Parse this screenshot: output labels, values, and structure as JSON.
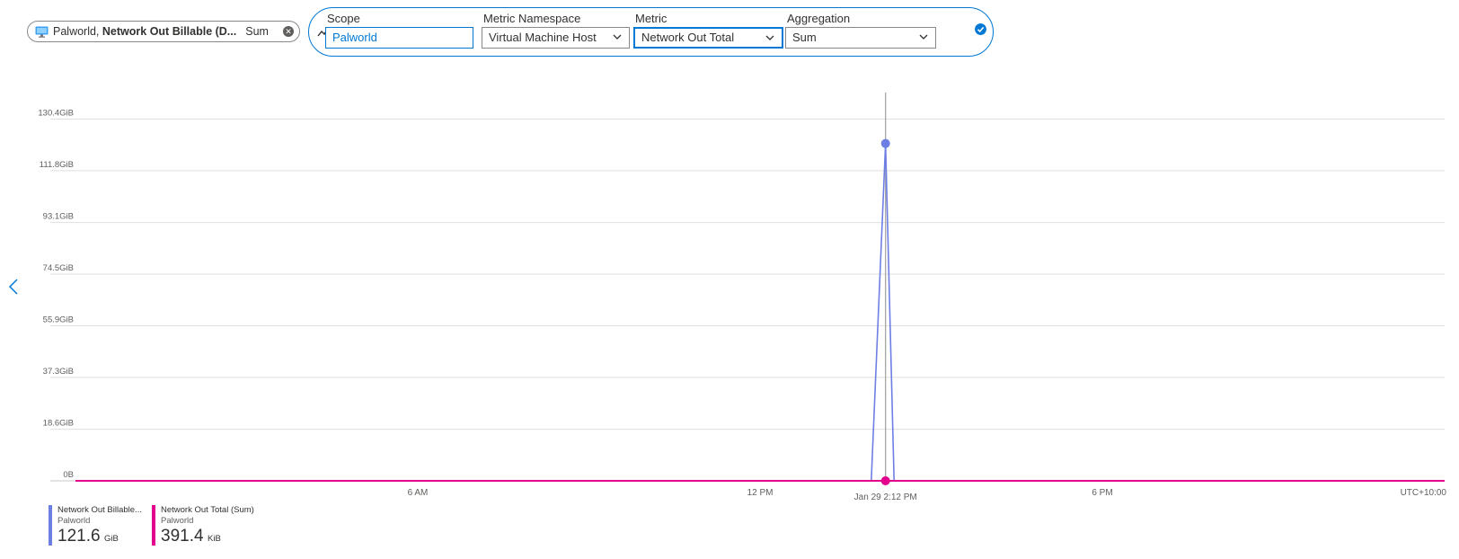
{
  "pill": {
    "resource": "Palworld,",
    "metric": "Network Out Billable (D...",
    "aggregation": "Sum",
    "icon": "vm-icon"
  },
  "editor": {
    "scope_label": "Scope",
    "scope_value": "Palworld",
    "namespace_label": "Metric Namespace",
    "namespace_value": "Virtual Machine Host",
    "metric_label": "Metric",
    "metric_value": "Network Out Total",
    "aggregation_label": "Aggregation",
    "aggregation_value": "Sum"
  },
  "colors": {
    "series_billable": "#6d7fe3",
    "series_total": "#e3008c",
    "accent": "#0078d4"
  },
  "chart_data": {
    "type": "line",
    "y_ticks": [
      "130.4GiB",
      "111.8GiB",
      "93.1GiB",
      "74.5GiB",
      "55.9GiB",
      "37.3GiB",
      "18.6GiB",
      "0B"
    ],
    "y_tick_values": [
      130.4,
      111.8,
      93.1,
      74.5,
      55.9,
      37.3,
      18.6,
      0
    ],
    "ylim": [
      0,
      130.4
    ],
    "x_ticks": [
      {
        "label": "6 AM",
        "hour": 6
      },
      {
        "label": "12 PM",
        "hour": 12
      },
      {
        "label": "6 PM",
        "hour": 18
      }
    ],
    "x_range_hours": [
      0,
      24
    ],
    "timezone": "UTC+10:00",
    "cursor": {
      "label": "Jan 29 2:12 PM",
      "hour": 14.2
    },
    "series": [
      {
        "name": "Network Out Billable...",
        "resource": "Palworld",
        "color": "#6d7fe3",
        "points": [
          [
            0,
            0
          ],
          [
            13.95,
            0
          ],
          [
            14.2,
            121.6
          ],
          [
            14.35,
            0
          ],
          [
            24,
            0
          ]
        ],
        "summary_value": "121.6",
        "summary_unit": "GiB"
      },
      {
        "name": "Network Out Total (Sum)",
        "resource": "Palworld",
        "color": "#e3008c",
        "points": [
          [
            0,
            0
          ],
          [
            24,
            0
          ]
        ],
        "summary_value": "391.4",
        "summary_unit": "KiB"
      }
    ],
    "grid": true
  }
}
